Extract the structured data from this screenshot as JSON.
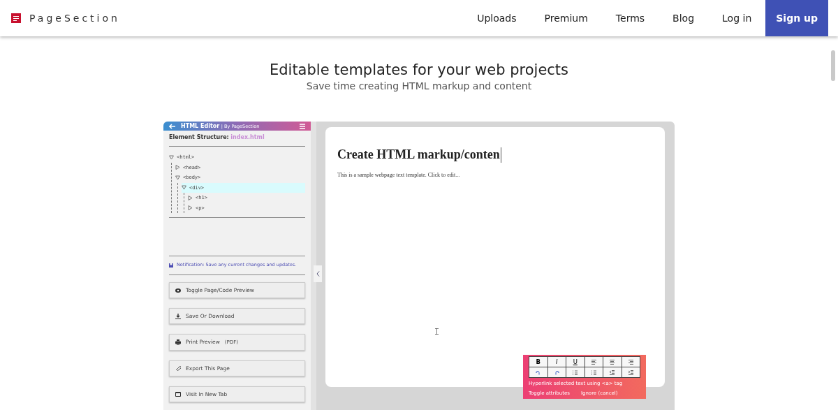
{
  "navbar": {
    "brand": "PageSection",
    "links": [
      {
        "label": "Uploads",
        "kind": "link"
      },
      {
        "label": "Premium",
        "kind": "link"
      },
      {
        "label": "Terms",
        "kind": "link"
      },
      {
        "label": "Blog",
        "kind": "link"
      },
      {
        "label": "Log in",
        "kind": "link"
      },
      {
        "label": "Sign up",
        "kind": "primary"
      }
    ]
  },
  "hero": {
    "title": "Editable templates for your web projects",
    "subtitle": "Save time creating HTML markup and content"
  },
  "editor": {
    "header": {
      "title": "HTML Editor",
      "byline": "| By PageSection"
    },
    "structure_label": "Element Structure:",
    "file": "index.html",
    "tree": [
      {
        "label": "<html>",
        "expanded": true,
        "selected": false,
        "children": [
          {
            "label": "<head>",
            "expanded": false,
            "selected": false
          },
          {
            "label": "<body>",
            "expanded": true,
            "selected": false,
            "children": [
              {
                "label": "<div>",
                "expanded": true,
                "selected": true,
                "children": [
                  {
                    "label": "<h1>",
                    "expanded": false,
                    "selected": false
                  },
                  {
                    "label": "<p>",
                    "expanded": false,
                    "selected": false
                  }
                ]
              }
            ]
          }
        ]
      }
    ],
    "notification": "Notification: Save any current changes and updates.",
    "actions": [
      {
        "label": "Toggle Page/Code Preview",
        "kind": "eye"
      },
      {
        "label": "Save Or Download",
        "kind": "download"
      },
      {
        "label": "Print Preview",
        "note": "(PDF)",
        "kind": "print"
      },
      {
        "label": "Export This Page",
        "kind": "link"
      },
      {
        "label": "Visit In New Tab",
        "kind": "window"
      }
    ],
    "preview": {
      "heading": "Create HTML markup/conten",
      "text": "This is a sample webpage text template. Click to edit..."
    },
    "toolbar": {
      "buttons": [
        {
          "kind": "text",
          "label": "B"
        },
        {
          "kind": "text",
          "label": "I"
        },
        {
          "kind": "text",
          "label": "U"
        },
        {
          "kind": "align-left"
        },
        {
          "kind": "align-center"
        },
        {
          "kind": "align-right"
        },
        {
          "kind": "undo"
        },
        {
          "kind": "redo"
        },
        {
          "kind": "ordered-list"
        },
        {
          "kind": "bullet-list"
        },
        {
          "kind": "outdent"
        },
        {
          "kind": "indent"
        }
      ],
      "hint": "Hyperlink selected text using <a> tag",
      "toggle": "Toggle attributes",
      "ignore": "Ignore (cancel)"
    }
  }
}
